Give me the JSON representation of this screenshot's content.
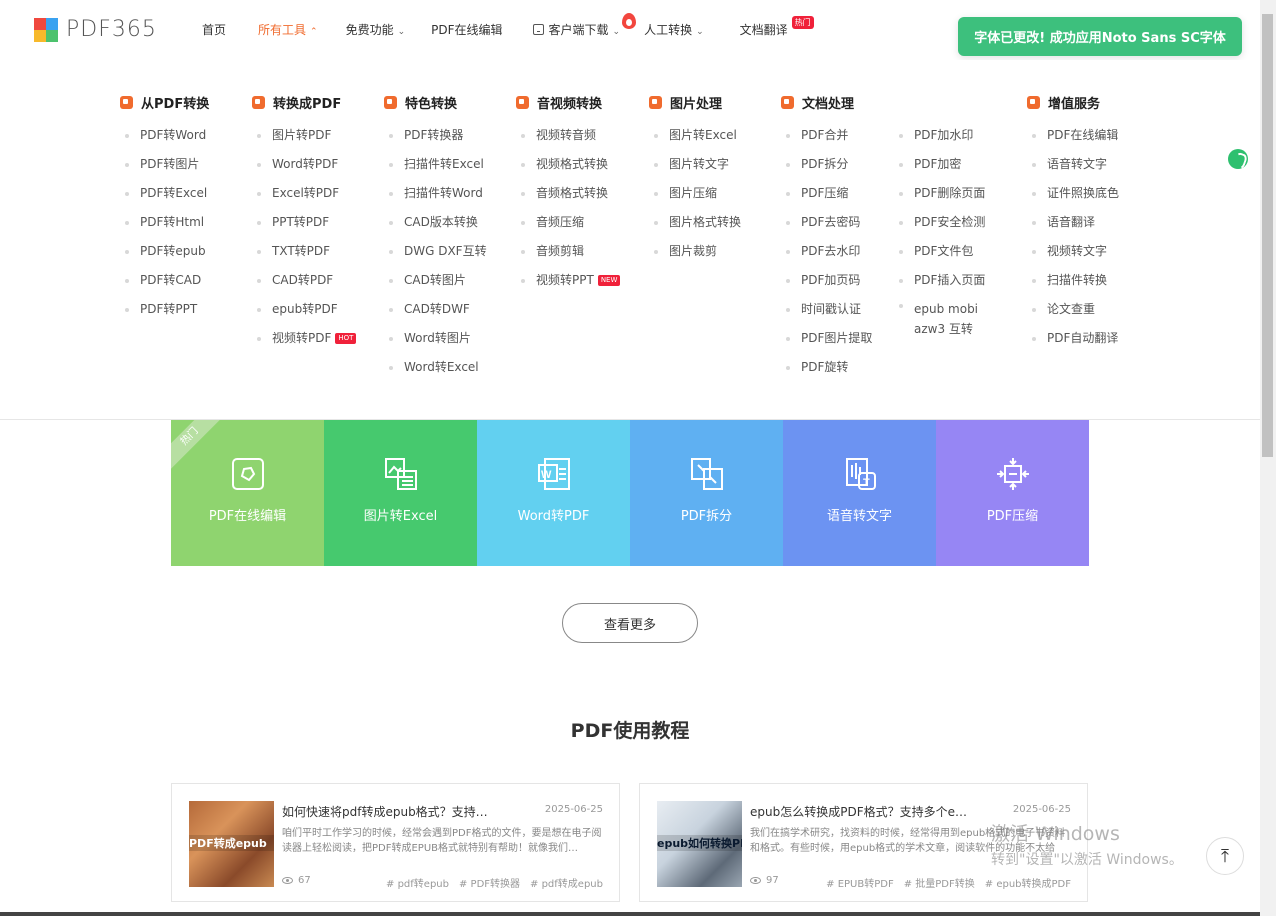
{
  "header": {
    "logo_text": "PDF365",
    "logo_colors": [
      "#f0483e",
      "#3aa2f0",
      "#f7b92b",
      "#4cc26d"
    ],
    "nav": [
      {
        "label": "首页",
        "chevron": false,
        "active": false
      },
      {
        "label": "所有工具",
        "chevron": true,
        "active": true
      },
      {
        "label": "免费功能",
        "chevron": true,
        "active": false
      },
      {
        "label": "PDF在线编辑",
        "chevron": false,
        "active": false
      },
      {
        "label": "客户端下载",
        "chevron": true,
        "active": false
      },
      {
        "label": "人工转换",
        "chevron": true,
        "active": false
      },
      {
        "label": "文档翻译",
        "chevron": false,
        "active": false
      }
    ],
    "hot_badge": "热门",
    "accent": "#f06b2e"
  },
  "toast": {
    "message": "字体已更改! 成功应用Noto Sans SC字体",
    "color": "#3dc07d"
  },
  "menu": {
    "columns": [
      {
        "title": "从PDF转换",
        "icon": "pdf-convert-icon",
        "color": "#f06b2e",
        "items": [
          "PDF转Word",
          "PDF转图片",
          "PDF转Excel",
          "PDF转Html",
          "PDF转epub",
          "PDF转CAD",
          "PDF转PPT"
        ]
      },
      {
        "title": "转换成PDF",
        "icon": "to-pdf-icon",
        "color": "#f06b2e",
        "items": [
          "图片转PDF",
          "Word转PDF",
          "Excel转PDF",
          "PPT转PDF",
          "TXT转PDF",
          "CAD转PDF",
          "epub转PDF",
          "视频转PDF"
        ]
      },
      {
        "title": "特色转换",
        "icon": "star-icon",
        "color": "#f06b2e",
        "items": [
          "PDF转换器",
          "扫描件转Excel",
          "扫描件转Word",
          "CAD版本转换",
          "DWG DXF互转",
          "CAD转图片",
          "CAD转DWF",
          "Word转图片",
          "Word转Excel"
        ]
      },
      {
        "title": "音视频转换",
        "icon": "media-icon",
        "color": "#f06b2e",
        "items": [
          "视频转音频",
          "视频格式转换",
          "音频格式转换",
          "音频压缩",
          "音频剪辑",
          "视频转PPT"
        ]
      },
      {
        "title": "图片处理",
        "icon": "image-icon",
        "color": "#f06b2e",
        "items": [
          "图片转Excel",
          "图片转文字",
          "图片压缩",
          "图片格式转换",
          "图片裁剪"
        ]
      },
      {
        "title": "文档处理",
        "icon": "document-icon",
        "color": "#f06b2e",
        "items": [
          "PDF合并",
          "PDF拆分",
          "PDF压缩",
          "PDF去密码",
          "PDF去水印",
          "PDF加页码",
          "时间戳认证",
          "PDF图片提取",
          "PDF旋转"
        ]
      },
      {
        "title": "",
        "icon": "",
        "color": "#f06b2e",
        "items": [
          "PDF加水印",
          "PDF加密",
          "PDF删除页面",
          "PDF安全检测",
          "PDF文件包",
          "PDF插入页面",
          "epub mobi azw3 互转"
        ]
      },
      {
        "title": "增值服务",
        "icon": "list-icon",
        "color": "#f06b2e",
        "items": [
          "PDF在线编辑",
          "语音转文字",
          "证件照换底色",
          "语音翻译",
          "视频转文字",
          "扫描件转换",
          "论文查重",
          "PDF自动翻译"
        ]
      }
    ],
    "tag_hot": "HOT",
    "tag_new": "NEW"
  },
  "tiles": {
    "ribbon": "热门",
    "items": [
      {
        "label": "PDF在线编辑",
        "color": "#8fd46f",
        "icon": "edit-icon"
      },
      {
        "label": "图片转Excel",
        "color": "#46c96e",
        "icon": "image-excel-icon"
      },
      {
        "label": "Word转PDF",
        "color": "#62d0f0",
        "icon": "word-icon"
      },
      {
        "label": "PDF拆分",
        "color": "#5fb0f2",
        "icon": "split-icon"
      },
      {
        "label": "语音转文字",
        "color": "#6c93f2",
        "icon": "voice-text-icon"
      },
      {
        "label": "PDF压缩",
        "color": "#9686f4",
        "icon": "compress-icon"
      }
    ]
  },
  "more_button": "查看更多",
  "tutorial": {
    "title": "PDF使用教程",
    "cards": [
      {
        "thumb_text": "PDF转成epub",
        "title": "如何快速将pdf转成epub格式？支持…",
        "date": "2025-06-25",
        "desc": "咱们平时工作学习的时候，经常会遇到PDF格式的文件，要是想在电子阅读器上轻松阅读，把PDF转成EPUB格式就特别有帮助！就像我们…",
        "views": "67",
        "tags": [
          "# pdf转epub",
          "# PDF转换器",
          "# pdf转成epub"
        ]
      },
      {
        "thumb_text": "epub如何转换PDF",
        "title": "epub怎么转换成PDF格式？支持多个e…",
        "date": "2025-06-25",
        "desc": "我们在搞学术研究，找资料的时候，经常得用到epub格式的电子书资料和格式。有些时候，用epub格式的学术文章，阅读软件的功能不太给力…",
        "views": "97",
        "tags": [
          "# EPUB转PDF",
          "# 批量PDF转换",
          "# epub转换成PDF"
        ]
      }
    ]
  },
  "watermark": {
    "line1": "激活 Windows",
    "line2": "转到\"设置\"以激活 Windows。"
  }
}
